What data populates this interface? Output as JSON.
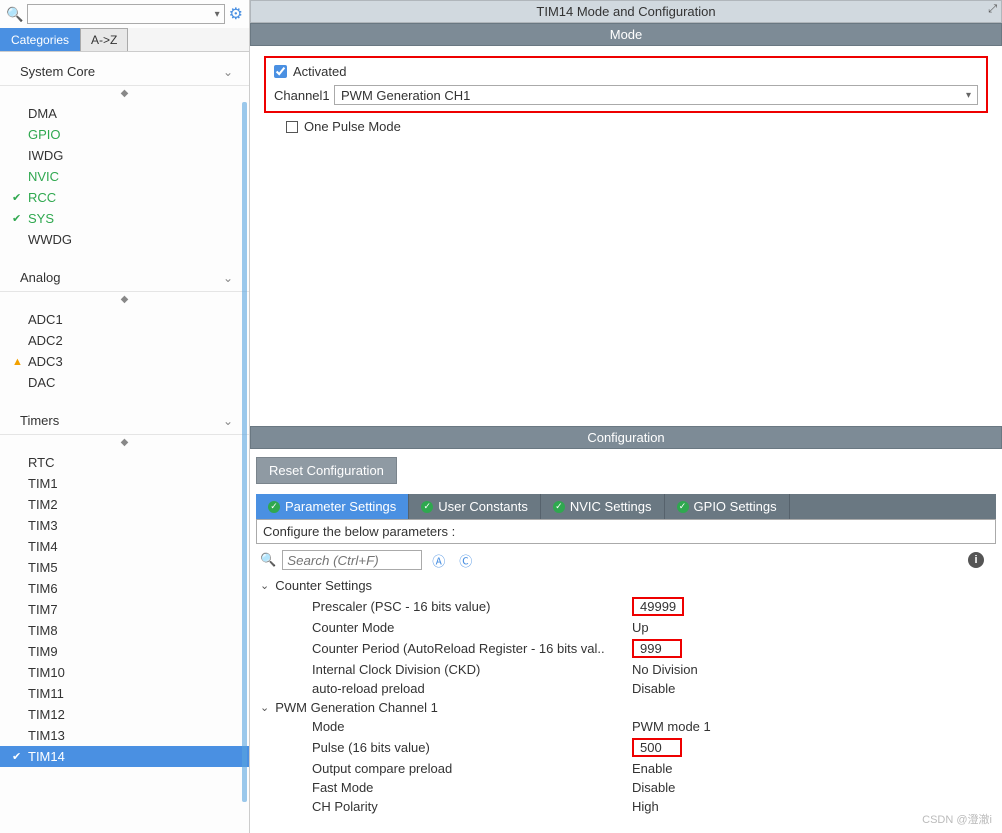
{
  "leftPanel": {
    "tabs": {
      "categories": "Categories",
      "az": "A->Z"
    },
    "sections": [
      {
        "name": "System Core",
        "items": [
          {
            "label": "DMA"
          },
          {
            "label": "GPIO",
            "green": true
          },
          {
            "label": "IWDG"
          },
          {
            "label": "NVIC",
            "green": true
          },
          {
            "label": "RCC",
            "green": true,
            "status": "ok"
          },
          {
            "label": "SYS",
            "green": true,
            "status": "ok"
          },
          {
            "label": "WWDG"
          }
        ]
      },
      {
        "name": "Analog",
        "items": [
          {
            "label": "ADC1"
          },
          {
            "label": "ADC2"
          },
          {
            "label": "ADC3",
            "status": "warn"
          },
          {
            "label": "DAC"
          }
        ]
      },
      {
        "name": "Timers",
        "items": [
          {
            "label": "RTC"
          },
          {
            "label": "TIM1"
          },
          {
            "label": "TIM2"
          },
          {
            "label": "TIM3"
          },
          {
            "label": "TIM4"
          },
          {
            "label": "TIM5"
          },
          {
            "label": "TIM6"
          },
          {
            "label": "TIM7"
          },
          {
            "label": "TIM8"
          },
          {
            "label": "TIM9"
          },
          {
            "label": "TIM10"
          },
          {
            "label": "TIM11"
          },
          {
            "label": "TIM12"
          },
          {
            "label": "TIM13"
          },
          {
            "label": "TIM14",
            "status": "ok",
            "selected": true
          }
        ]
      }
    ]
  },
  "rightPanel": {
    "title": "TIM14 Mode and Configuration",
    "modeTitle": "Mode",
    "activated": {
      "label": "Activated",
      "checked": true
    },
    "channel": {
      "label": "Channel1",
      "value": "PWM Generation CH1"
    },
    "onePulse": {
      "label": "One Pulse Mode",
      "checked": false
    },
    "configTitle": "Configuration",
    "resetBtn": "Reset Configuration",
    "confTabs": {
      "param": "Parameter Settings",
      "user": "User Constants",
      "nvic": "NVIC Settings",
      "gpio": "GPIO Settings"
    },
    "descLine": "Configure the below parameters :",
    "searchPlaceholder": "Search (Ctrl+F)",
    "groups": [
      {
        "name": "Counter Settings",
        "params": [
          {
            "name": "Prescaler (PSC - 16 bits value)",
            "value": "49999",
            "boxed": true
          },
          {
            "name": "Counter Mode",
            "value": "Up"
          },
          {
            "name": "Counter Period (AutoReload Register - 16 bits val..",
            "value": "999",
            "boxed": true
          },
          {
            "name": "Internal Clock Division (CKD)",
            "value": "No Division"
          },
          {
            "name": "auto-reload preload",
            "value": "Disable"
          }
        ]
      },
      {
        "name": "PWM Generation Channel 1",
        "params": [
          {
            "name": "Mode",
            "value": "PWM mode 1"
          },
          {
            "name": "Pulse (16 bits value)",
            "value": "500",
            "boxed": true
          },
          {
            "name": "Output compare preload",
            "value": "Enable"
          },
          {
            "name": "Fast Mode",
            "value": "Disable"
          },
          {
            "name": "CH Polarity",
            "value": "High"
          }
        ]
      }
    ]
  },
  "watermark": "CSDN @澄澈i"
}
